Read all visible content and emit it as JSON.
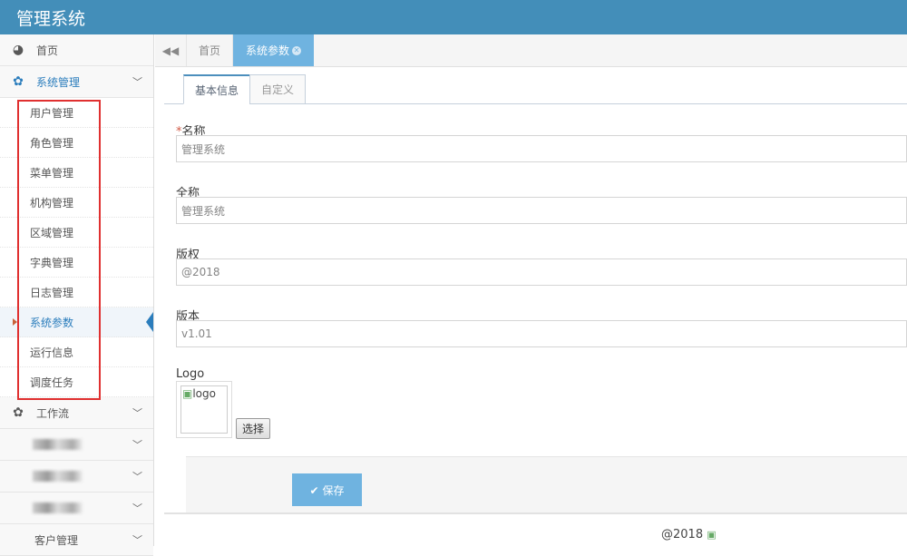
{
  "header": {
    "title": "管理系统"
  },
  "sidebar": {
    "home": "首页",
    "system": "系统管理",
    "sub": [
      "用户管理",
      "角色管理",
      "菜单管理",
      "机构管理",
      "区域管理",
      "字典管理",
      "日志管理",
      "系统参数",
      "运行信息",
      "调度任务"
    ],
    "workflow": "工作流",
    "customer": "客户管理"
  },
  "tabs": {
    "home": "首页",
    "active": "系统参数"
  },
  "inner_tabs": [
    "基本信息",
    "自定义"
  ],
  "form": {
    "name_label": "名称",
    "name_value": "管理系统",
    "fullname_label": "全称",
    "fullname_value": "管理系统",
    "copyright_label": "版权",
    "copyright_value": "@2018",
    "version_label": "版本",
    "version_value": "v1.01",
    "logo_label": "Logo",
    "logo_alt": "logo",
    "pick_label": "选择",
    "save_label": "保存"
  },
  "footer": {
    "text": "@2018"
  },
  "colors": {
    "header": "#438eb9",
    "accent": "#6fb3e0",
    "highlight": "#e03030"
  }
}
